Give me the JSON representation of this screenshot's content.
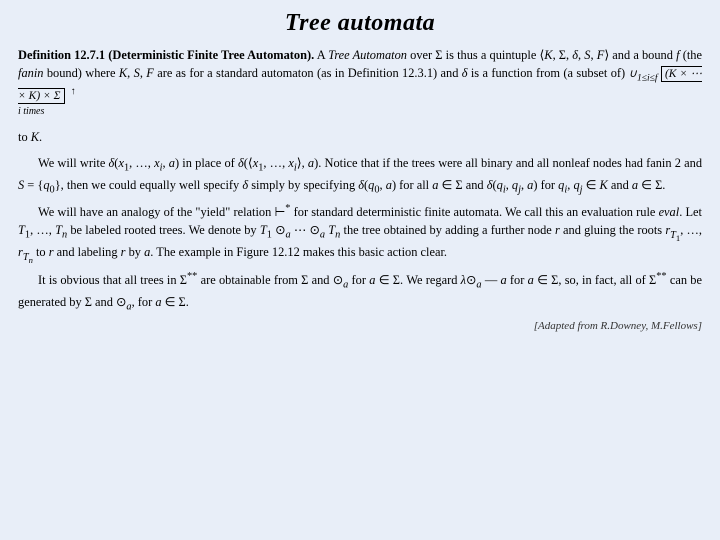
{
  "page": {
    "title": "Tree automata",
    "attribution": "[Adapted from R.Downey, M.Fellows]",
    "definition": {
      "label": "Definition 12.7.1",
      "name_bold": "(Deterministic Finite Tree Automaton).",
      "intro": "A",
      "tree_italic": "Tree Automaton",
      "over": "over",
      "sigma": "Σ",
      "quintuple_text": "is thus a quintuple",
      "quintuple_math": "⟨K, Σ, δ, S, F⟩",
      "and_bound": "and a bound",
      "f_italic": "f",
      "fanin_paren": "(the",
      "fanin_italic": "fanin",
      "bound_text": "bound) where K, S, F are as for a standard automaton (as in Definition 12.3.1) and δ is a function from (a subset of)",
      "union_notation": "∪₁≤ᵢ≤f",
      "box_content": "(K × ⋯ × K) × Σ",
      "i_times": "i times",
      "to_K": "to K."
    },
    "paragraphs": [
      "We will write δ(x₁, …, xᵢ, a) in place of δ(⟨x₁, …, xᵢ⟩, a). Notice that if the trees were all binary and all nonleaf nodes had fanin 2 and S = {q₀}, then we could equally well specify δ simply by specifying δ(q₀, a) for all a ∈ Σ and δ(qᵢ, qⱼ, a) for qᵢ, qⱼ ∈ K and a ∈ Σ.",
      "We will have an analogy of the \"yield\" relation ⊢* for standard deterministic finite automata. We call this an evaluation rule eval. Let T₁, …, Tₙ be labeled rooted trees. We denote by T₁ ⊙ₐ ⋯ ⊙ₐ Tₙ the tree obtained by adding a further node r and gluing the roots r_{T₁}, …, r_{Tₙ} to r and labeling r by a. The example in Figure 12.12 makes this basic action clear.",
      "It is obvious that all trees in Σ** are obtainable from Σ and ⊙ₐ for a ∈ Σ. We regard λ⊙ₐ — a for a ∈ Σ, so, in fact, all of Σ** can be generated by Σ and ⊙ₐ, for a ∈ Σ."
    ]
  }
}
